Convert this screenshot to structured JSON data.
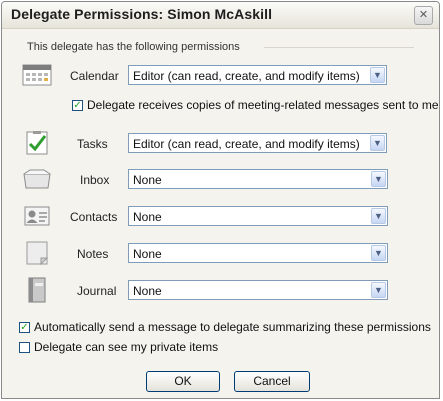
{
  "dialog": {
    "title": "Delegate Permissions: Simon McAskill",
    "close_glyph": "✕",
    "intro": "This delegate has the following permissions"
  },
  "permissions": [
    {
      "label": "Calendar",
      "icon": "calendar-icon",
      "value": "Editor (can read, create, and modify items)"
    },
    {
      "label": "Tasks",
      "icon": "tasks-icon",
      "value": "Editor (can read, create, and modify items)"
    },
    {
      "label": "Inbox",
      "icon": "inbox-icon",
      "value": "None"
    },
    {
      "label": "Contacts",
      "icon": "contacts-icon",
      "value": "None"
    },
    {
      "label": "Notes",
      "icon": "notes-icon",
      "value": "None"
    },
    {
      "label": "Journal",
      "icon": "journal-icon",
      "value": "None"
    }
  ],
  "options": {
    "meeting_copies": {
      "label": "Delegate receives copies of meeting-related messages sent to me",
      "checked": true
    },
    "auto_send_summary": {
      "label": "Automatically send a message to delegate summarizing these permissions",
      "checked": true
    },
    "private_items": {
      "label": "Delegate can see my private items",
      "checked": false
    }
  },
  "buttons": {
    "ok": "OK",
    "cancel": "Cancel"
  },
  "dropdown_glyph": "▼",
  "check_glyph": "✓"
}
